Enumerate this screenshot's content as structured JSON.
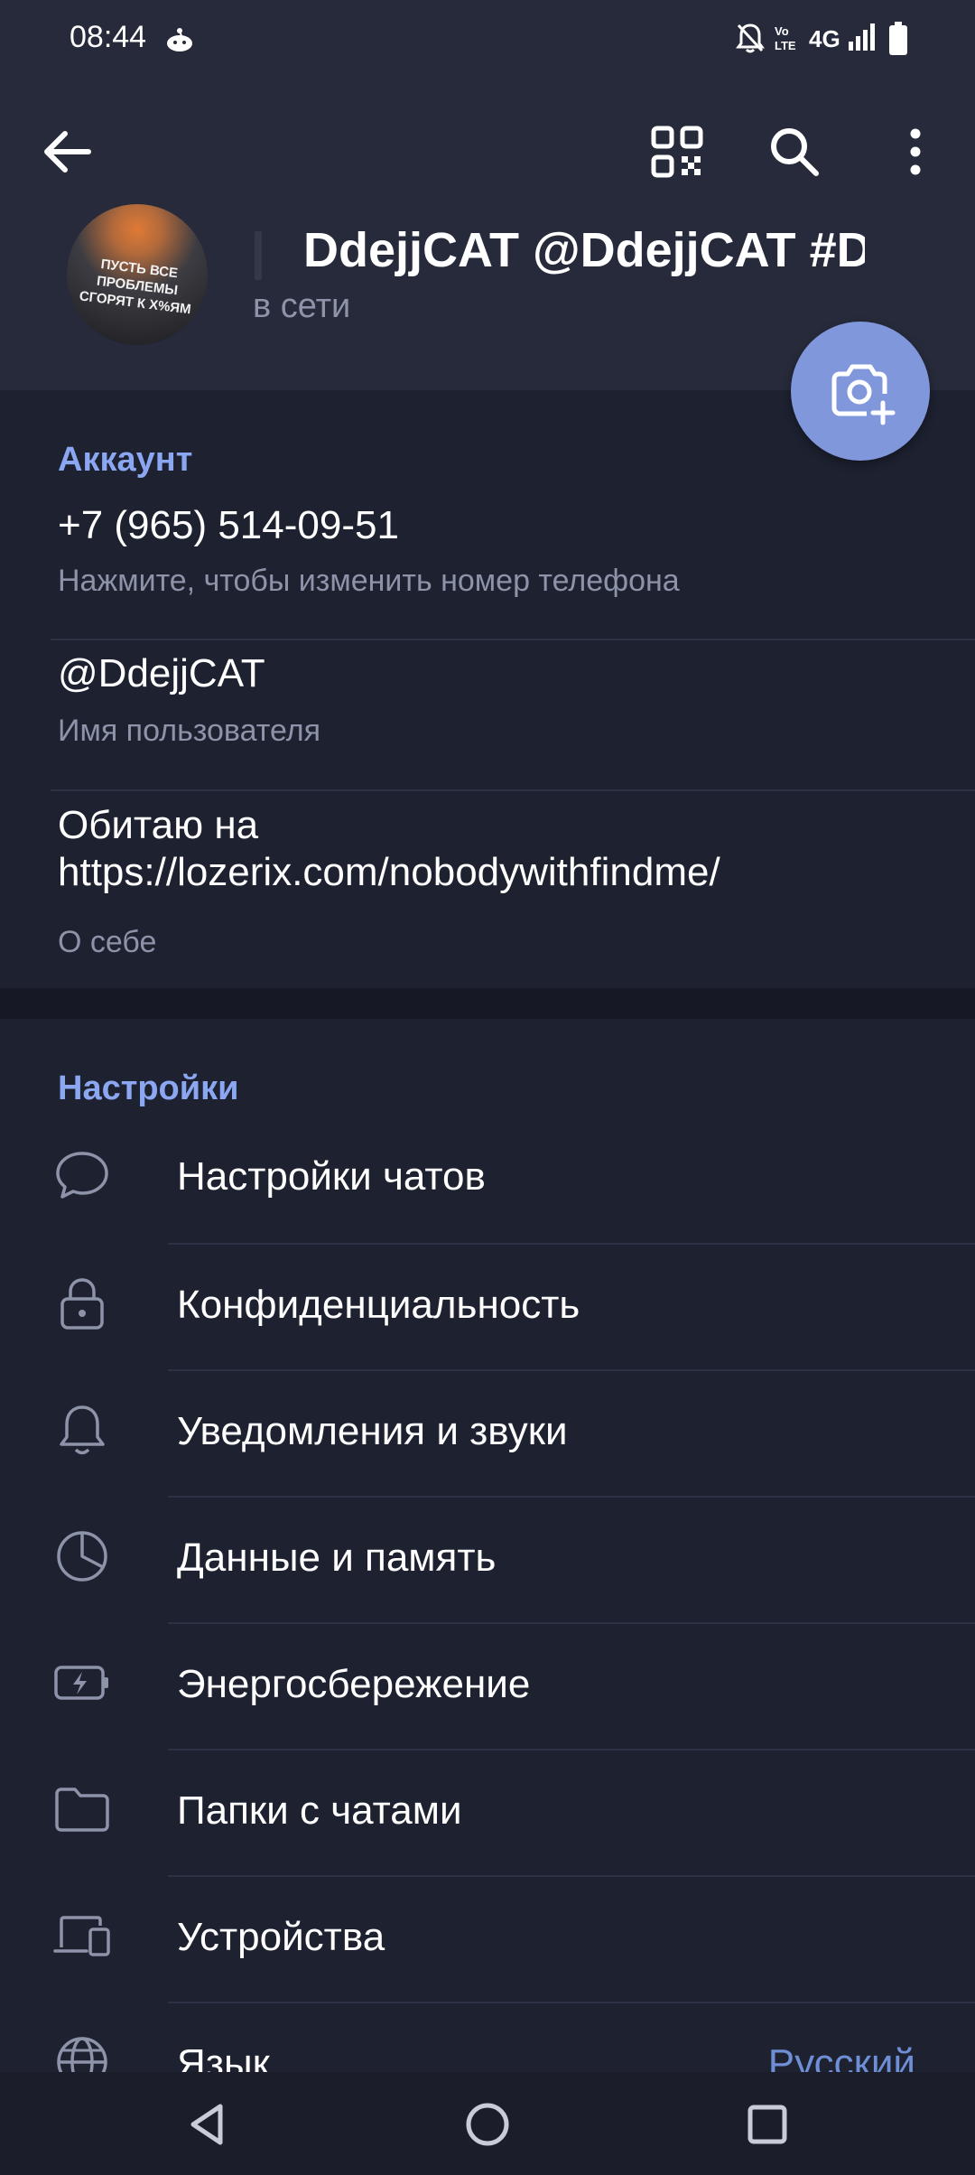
{
  "status_bar": {
    "time": "08:44",
    "network": "4G"
  },
  "profile": {
    "name": "DdejjCAT @DdejjCAT #Dd",
    "status": "в сети",
    "avatar_text": "ПУСТЬ ВСЕ ПРОБЛЕМЫ СГОРЯТ К Х%ЯМ"
  },
  "account": {
    "title": "Аккаунт",
    "phone": "+7 (965) 514-09-51",
    "phone_hint": "Нажмите, чтобы изменить номер телефона",
    "username": "@DdejjCAT",
    "username_hint": "Имя пользователя",
    "bio": "Обитаю на https://lozerix.com/nobodywithfindme/",
    "bio_hint": "О себе"
  },
  "settings": {
    "title": "Настройки",
    "items": [
      {
        "label": "Настройки чатов",
        "icon": "chat-bubble-icon"
      },
      {
        "label": "Конфиденциальность",
        "icon": "lock-icon"
      },
      {
        "label": "Уведомления и звуки",
        "icon": "bell-icon"
      },
      {
        "label": "Данные и память",
        "icon": "pie-chart-icon"
      },
      {
        "label": "Энергосбережение",
        "icon": "battery-icon"
      },
      {
        "label": "Папки с чатами",
        "icon": "folder-icon"
      },
      {
        "label": "Устройства",
        "icon": "devices-icon"
      },
      {
        "label": "Язык",
        "icon": "globe-icon",
        "value": "Русский"
      }
    ]
  },
  "colors": {
    "accent": "#8ca7f2",
    "fab": "#8197dc",
    "background": "#1d2130",
    "header": "#262a3a"
  }
}
